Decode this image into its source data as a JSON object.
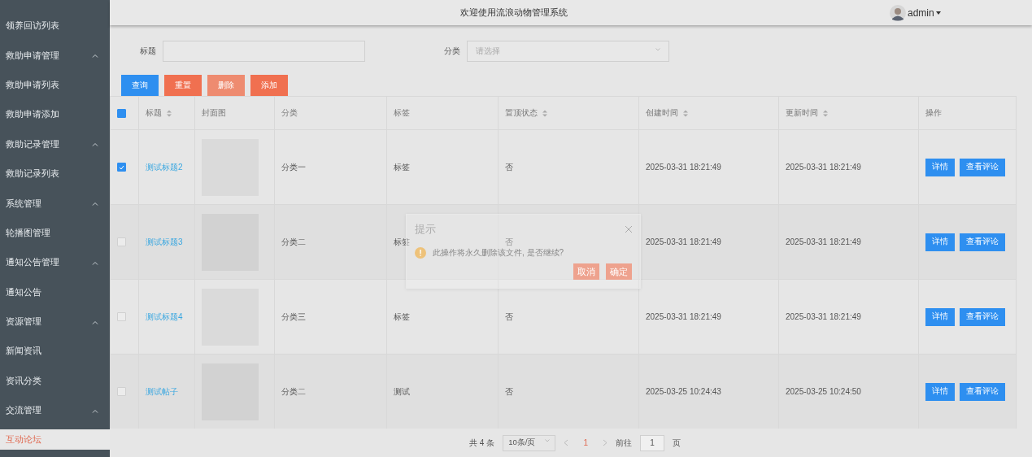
{
  "header": {
    "title": "欢迎使用流浪动物管理系统",
    "user": "admin"
  },
  "sidebar": {
    "items": [
      {
        "label": "领养回访列表",
        "selected": false
      },
      {
        "label": "救助申请管理",
        "expanded": true,
        "children": [
          {
            "label": "救助申请列表",
            "selected": false
          },
          {
            "label": "救助申请添加",
            "selected": false
          }
        ]
      },
      {
        "label": "救助记录管理",
        "expanded": true,
        "children": [
          {
            "label": "救助记录列表",
            "selected": false
          }
        ]
      },
      {
        "label": "系统管理",
        "expanded": true,
        "children": [
          {
            "label": "轮播图管理",
            "selected": false
          }
        ]
      },
      {
        "label": "通知公告管理",
        "expanded": true,
        "children": [
          {
            "label": "通知公告",
            "selected": false
          }
        ]
      },
      {
        "label": "资源管理",
        "expanded": true,
        "children": [
          {
            "label": "新闻资讯",
            "selected": false
          },
          {
            "label": "资讯分类",
            "selected": false
          }
        ]
      },
      {
        "label": "交流管理",
        "expanded": true,
        "children": [
          {
            "label": "互动论坛",
            "selected": true
          }
        ]
      }
    ]
  },
  "filters": [
    {
      "label": "标题",
      "kind": "text"
    },
    {
      "label": "分类",
      "kind": "select",
      "placeholder": "请选择"
    }
  ],
  "actions": [
    {
      "label": "查询",
      "kind": "primary",
      "disabled": false
    },
    {
      "label": "重置",
      "kind": "danger",
      "disabled": false
    },
    {
      "label": "删除",
      "kind": "danger",
      "disabled": true
    },
    {
      "label": "添加",
      "kind": "danger",
      "disabled": false
    }
  ],
  "table": {
    "select_all_indeterminate": true,
    "columns": [
      {
        "label": "标题",
        "sortable": true
      },
      {
        "label": "封面图",
        "sortable": false
      },
      {
        "label": "分类",
        "sortable": false
      },
      {
        "label": "标签",
        "sortable": false
      },
      {
        "label": "置顶状态",
        "sortable": true
      },
      {
        "label": "创建时间",
        "sortable": true
      },
      {
        "label": "更新时间",
        "sortable": true
      },
      {
        "label": "操作",
        "sortable": false
      }
    ],
    "rows": [
      {
        "checked": true,
        "title": "测试标题2",
        "category": "分类一",
        "tag": "标签",
        "pinned": "否",
        "created": "2025-03-31 18:21:49",
        "updated": "2025-03-31 18:21:49",
        "buttons": [
          "详情",
          "查看评论"
        ]
      },
      {
        "checked": false,
        "title": "测试标题3",
        "category": "分类二",
        "tag": "标签",
        "pinned": "否",
        "created": "2025-03-31 18:21:49",
        "updated": "2025-03-31 18:21:49",
        "buttons": [
          "详情",
          "查看评论"
        ]
      },
      {
        "checked": false,
        "title": "测试标题4",
        "category": "分类三",
        "tag": "标签",
        "pinned": "否",
        "created": "2025-03-31 18:21:49",
        "updated": "2025-03-31 18:21:49",
        "buttons": [
          "详情",
          "查看评论"
        ]
      },
      {
        "checked": false,
        "title": "测试帖子",
        "category": "分类二",
        "tag": "测试",
        "pinned": "否",
        "created": "2025-03-25 10:24:43",
        "updated": "2025-03-25 10:24:50",
        "buttons": [
          "详情",
          "查看评论"
        ]
      }
    ]
  },
  "pagination": {
    "total": "共 4 条",
    "page_size": "10条/页",
    "pages": [
      {
        "label": "1",
        "selected": true
      }
    ],
    "goto_label": "前往",
    "goto_value": "1",
    "goto_suffix": "页"
  },
  "dialog": {
    "title": "提示",
    "message": "此操作将永久删除该文件, 是否继续?",
    "buttons": [
      "取消",
      "确定"
    ]
  }
}
